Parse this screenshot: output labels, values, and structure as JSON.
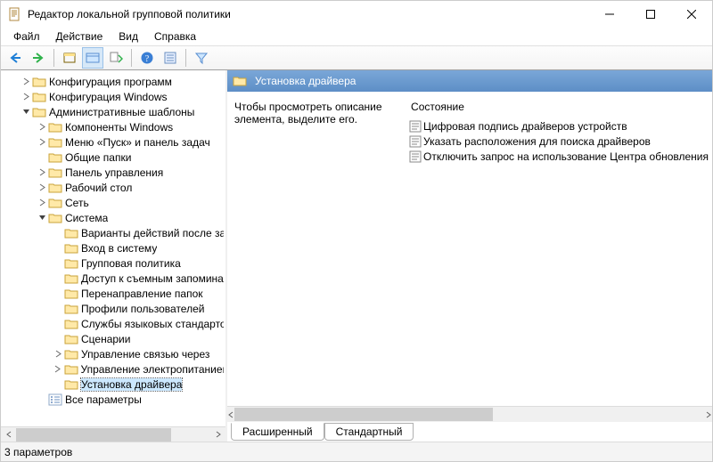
{
  "window": {
    "title": "Редактор локальной групповой политики"
  },
  "menu": {
    "file": "Файл",
    "action": "Действие",
    "view": "Вид",
    "help": "Справка"
  },
  "tree": {
    "n0": "Конфигурация программ",
    "n1": "Конфигурация Windows",
    "n2": "Административные шаблоны",
    "n2_0": "Компоненты Windows",
    "n2_1": "Меню «Пуск» и панель задач",
    "n2_2": "Общие папки",
    "n2_3": "Панель управления",
    "n2_4": "Рабочий стол",
    "n2_5": "Сеть",
    "n2_6": "Система",
    "n2_6_0": "Варианты действий после завершения",
    "n2_6_1": "Вход в систему",
    "n2_6_2": "Групповая политика",
    "n2_6_3": "Доступ к съемным запоминающим",
    "n2_6_4": "Перенаправление папок",
    "n2_6_5": "Профили пользователей",
    "n2_6_6": "Службы языковых стандартов",
    "n2_6_7": "Сценарии",
    "n2_6_8": "Управление связью через",
    "n2_6_9": "Управление электропитанием",
    "n2_6_10": "Установка драйвера",
    "n3": "Все параметры"
  },
  "right": {
    "heading": "Установка драйвера",
    "description": "Чтобы просмотреть описание элемента, выделите его.",
    "column_header": "Состояние",
    "items": {
      "i0": "Цифровая подпись драйверов устройств",
      "i1": "Указать расположения для поиска драйверов",
      "i2": "Отключить запрос на использование Центра обновления"
    }
  },
  "tabs": {
    "extended": "Расширенный",
    "standard": "Стандартный"
  },
  "status": {
    "text": "3 параметров"
  }
}
